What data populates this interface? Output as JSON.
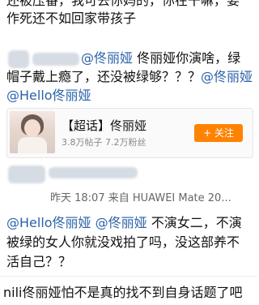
{
  "post1": {
    "line1": "还被压番，我可去你妈的，你在干嘛，要",
    "line2": "作死还不如回家带孩子"
  },
  "comment1": {
    "mention_head": "@佟丽娅",
    "line1_rest": " 佟丽娅你演啥，绿",
    "line2": "帽子戴上瘾了，还没被绿够？？？",
    "line2_mention": "@佟丽娅",
    "line3_mention": "@Hello佟丽娅"
  },
  "topic_card": {
    "title": "【超话】佟丽娅",
    "stats": "3.8万帖子  7.2万粉丝",
    "follow_label": "+ 关注"
  },
  "comment2": {
    "meta": "昨天 18:07  来自 HUAWEI Mate 20...",
    "line1_m1": "@Hello佟丽娅",
    "line1_m2": "@佟丽娅",
    "line1_rest": " 不演女二，不演",
    "line2": "被绿的女人你就没戏拍了吗，没这部养不",
    "line3": "活自己？？"
  },
  "post3": {
    "line1": "nili佟丽娅怕不是真的找不到自身话题了吧"
  }
}
